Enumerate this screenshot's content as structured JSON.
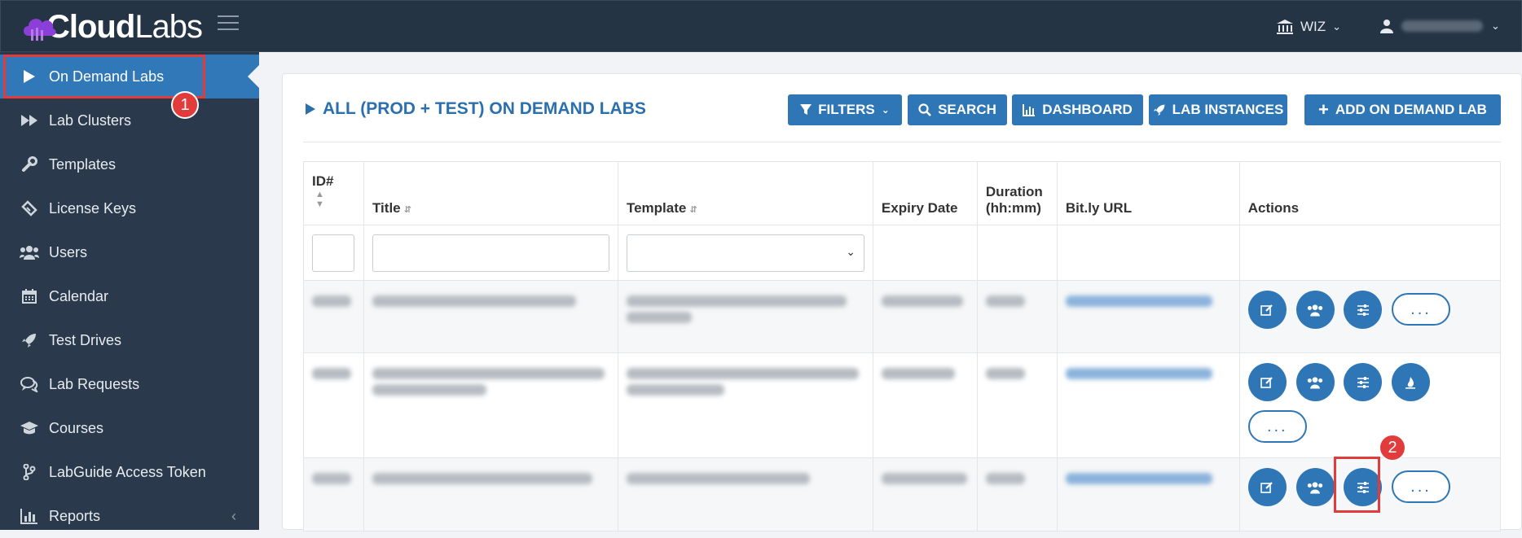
{
  "app": {
    "logo_main": "Cloud",
    "logo_thin": "Labs"
  },
  "topbar": {
    "org_label": "WIZ",
    "user_name": ""
  },
  "sidebar": {
    "items": [
      {
        "label": "On Demand Labs",
        "icon": "play-icon"
      },
      {
        "label": "Lab Clusters",
        "icon": "fast-forward-icon"
      },
      {
        "label": "Templates",
        "icon": "wrench-icon"
      },
      {
        "label": "License Keys",
        "icon": "ticket-icon"
      },
      {
        "label": "Users",
        "icon": "users-icon"
      },
      {
        "label": "Calendar",
        "icon": "calendar-icon"
      },
      {
        "label": "Test Drives",
        "icon": "rocket-icon"
      },
      {
        "label": "Lab Requests",
        "icon": "comments-icon"
      },
      {
        "label": "Courses",
        "icon": "graduation-cap-icon"
      },
      {
        "label": "LabGuide Access Token",
        "icon": "branch-icon"
      },
      {
        "label": "Reports",
        "icon": "bar-chart-icon"
      }
    ]
  },
  "annotations": {
    "step1": "1",
    "step2": "2"
  },
  "main": {
    "title": "ALL (PROD + TEST) ON DEMAND LABS",
    "toolbar": {
      "filters": "FILTERS",
      "search": "SEARCH",
      "dashboard": "DASHBOARD",
      "lab_instances": "LAB INSTANCES",
      "add": "ADD ON DEMAND LAB"
    },
    "columns": {
      "id": "ID#",
      "title": "Title",
      "template": "Template",
      "expiry": "Expiry Date",
      "duration_1": "Duration",
      "duration_2": "(hh:mm)",
      "bitly": "Bit.ly URL",
      "actions": "Actions"
    },
    "more_label": "..."
  },
  "colors": {
    "accent": "#2e76b6",
    "sidebar": "#2a3a4c",
    "topbar": "#243445",
    "highlight": "#e23b3b"
  }
}
